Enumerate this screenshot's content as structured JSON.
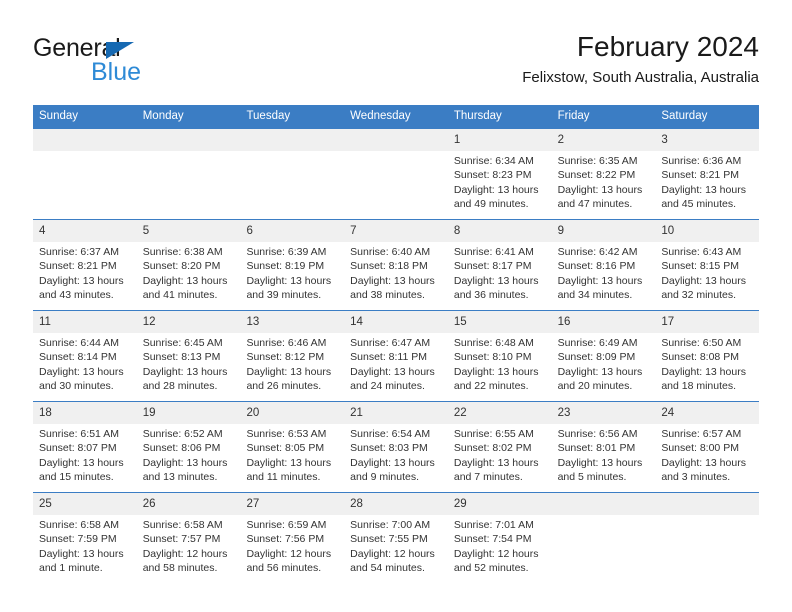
{
  "brand": {
    "name_dark": "General",
    "name_blue": "Blue",
    "accent_blue": "#2e8ad6",
    "triangle_blue": "#1669b2"
  },
  "header": {
    "title": "February 2024",
    "subtitle": "Felixstow, South Australia, Australia"
  },
  "theme": {
    "header_bar": "#3b7dc4",
    "day_band": "#f0f0f0",
    "text": "#333333"
  },
  "weekdays": [
    "Sunday",
    "Monday",
    "Tuesday",
    "Wednesday",
    "Thursday",
    "Friday",
    "Saturday"
  ],
  "weeks": [
    [
      {
        "day": "",
        "empty": true
      },
      {
        "day": "",
        "empty": true
      },
      {
        "day": "",
        "empty": true
      },
      {
        "day": "",
        "empty": true
      },
      {
        "day": "1",
        "sunrise": "Sunrise: 6:34 AM",
        "sunset": "Sunset: 8:23 PM",
        "daylight1": "Daylight: 13 hours",
        "daylight2": "and 49 minutes."
      },
      {
        "day": "2",
        "sunrise": "Sunrise: 6:35 AM",
        "sunset": "Sunset: 8:22 PM",
        "daylight1": "Daylight: 13 hours",
        "daylight2": "and 47 minutes."
      },
      {
        "day": "3",
        "sunrise": "Sunrise: 6:36 AM",
        "sunset": "Sunset: 8:21 PM",
        "daylight1": "Daylight: 13 hours",
        "daylight2": "and 45 minutes."
      }
    ],
    [
      {
        "day": "4",
        "sunrise": "Sunrise: 6:37 AM",
        "sunset": "Sunset: 8:21 PM",
        "daylight1": "Daylight: 13 hours",
        "daylight2": "and 43 minutes."
      },
      {
        "day": "5",
        "sunrise": "Sunrise: 6:38 AM",
        "sunset": "Sunset: 8:20 PM",
        "daylight1": "Daylight: 13 hours",
        "daylight2": "and 41 minutes."
      },
      {
        "day": "6",
        "sunrise": "Sunrise: 6:39 AM",
        "sunset": "Sunset: 8:19 PM",
        "daylight1": "Daylight: 13 hours",
        "daylight2": "and 39 minutes."
      },
      {
        "day": "7",
        "sunrise": "Sunrise: 6:40 AM",
        "sunset": "Sunset: 8:18 PM",
        "daylight1": "Daylight: 13 hours",
        "daylight2": "and 38 minutes."
      },
      {
        "day": "8",
        "sunrise": "Sunrise: 6:41 AM",
        "sunset": "Sunset: 8:17 PM",
        "daylight1": "Daylight: 13 hours",
        "daylight2": "and 36 minutes."
      },
      {
        "day": "9",
        "sunrise": "Sunrise: 6:42 AM",
        "sunset": "Sunset: 8:16 PM",
        "daylight1": "Daylight: 13 hours",
        "daylight2": "and 34 minutes."
      },
      {
        "day": "10",
        "sunrise": "Sunrise: 6:43 AM",
        "sunset": "Sunset: 8:15 PM",
        "daylight1": "Daylight: 13 hours",
        "daylight2": "and 32 minutes."
      }
    ],
    [
      {
        "day": "11",
        "sunrise": "Sunrise: 6:44 AM",
        "sunset": "Sunset: 8:14 PM",
        "daylight1": "Daylight: 13 hours",
        "daylight2": "and 30 minutes."
      },
      {
        "day": "12",
        "sunrise": "Sunrise: 6:45 AM",
        "sunset": "Sunset: 8:13 PM",
        "daylight1": "Daylight: 13 hours",
        "daylight2": "and 28 minutes."
      },
      {
        "day": "13",
        "sunrise": "Sunrise: 6:46 AM",
        "sunset": "Sunset: 8:12 PM",
        "daylight1": "Daylight: 13 hours",
        "daylight2": "and 26 minutes."
      },
      {
        "day": "14",
        "sunrise": "Sunrise: 6:47 AM",
        "sunset": "Sunset: 8:11 PM",
        "daylight1": "Daylight: 13 hours",
        "daylight2": "and 24 minutes."
      },
      {
        "day": "15",
        "sunrise": "Sunrise: 6:48 AM",
        "sunset": "Sunset: 8:10 PM",
        "daylight1": "Daylight: 13 hours",
        "daylight2": "and 22 minutes."
      },
      {
        "day": "16",
        "sunrise": "Sunrise: 6:49 AM",
        "sunset": "Sunset: 8:09 PM",
        "daylight1": "Daylight: 13 hours",
        "daylight2": "and 20 minutes."
      },
      {
        "day": "17",
        "sunrise": "Sunrise: 6:50 AM",
        "sunset": "Sunset: 8:08 PM",
        "daylight1": "Daylight: 13 hours",
        "daylight2": "and 18 minutes."
      }
    ],
    [
      {
        "day": "18",
        "sunrise": "Sunrise: 6:51 AM",
        "sunset": "Sunset: 8:07 PM",
        "daylight1": "Daylight: 13 hours",
        "daylight2": "and 15 minutes."
      },
      {
        "day": "19",
        "sunrise": "Sunrise: 6:52 AM",
        "sunset": "Sunset: 8:06 PM",
        "daylight1": "Daylight: 13 hours",
        "daylight2": "and 13 minutes."
      },
      {
        "day": "20",
        "sunrise": "Sunrise: 6:53 AM",
        "sunset": "Sunset: 8:05 PM",
        "daylight1": "Daylight: 13 hours",
        "daylight2": "and 11 minutes."
      },
      {
        "day": "21",
        "sunrise": "Sunrise: 6:54 AM",
        "sunset": "Sunset: 8:03 PM",
        "daylight1": "Daylight: 13 hours",
        "daylight2": "and 9 minutes."
      },
      {
        "day": "22",
        "sunrise": "Sunrise: 6:55 AM",
        "sunset": "Sunset: 8:02 PM",
        "daylight1": "Daylight: 13 hours",
        "daylight2": "and 7 minutes."
      },
      {
        "day": "23",
        "sunrise": "Sunrise: 6:56 AM",
        "sunset": "Sunset: 8:01 PM",
        "daylight1": "Daylight: 13 hours",
        "daylight2": "and 5 minutes."
      },
      {
        "day": "24",
        "sunrise": "Sunrise: 6:57 AM",
        "sunset": "Sunset: 8:00 PM",
        "daylight1": "Daylight: 13 hours",
        "daylight2": "and 3 minutes."
      }
    ],
    [
      {
        "day": "25",
        "sunrise": "Sunrise: 6:58 AM",
        "sunset": "Sunset: 7:59 PM",
        "daylight1": "Daylight: 13 hours",
        "daylight2": "and 1 minute."
      },
      {
        "day": "26",
        "sunrise": "Sunrise: 6:58 AM",
        "sunset": "Sunset: 7:57 PM",
        "daylight1": "Daylight: 12 hours",
        "daylight2": "and 58 minutes."
      },
      {
        "day": "27",
        "sunrise": "Sunrise: 6:59 AM",
        "sunset": "Sunset: 7:56 PM",
        "daylight1": "Daylight: 12 hours",
        "daylight2": "and 56 minutes."
      },
      {
        "day": "28",
        "sunrise": "Sunrise: 7:00 AM",
        "sunset": "Sunset: 7:55 PM",
        "daylight1": "Daylight: 12 hours",
        "daylight2": "and 54 minutes."
      },
      {
        "day": "29",
        "sunrise": "Sunrise: 7:01 AM",
        "sunset": "Sunset: 7:54 PM",
        "daylight1": "Daylight: 12 hours",
        "daylight2": "and 52 minutes."
      },
      {
        "day": "",
        "empty": true
      },
      {
        "day": "",
        "empty": true
      }
    ]
  ]
}
